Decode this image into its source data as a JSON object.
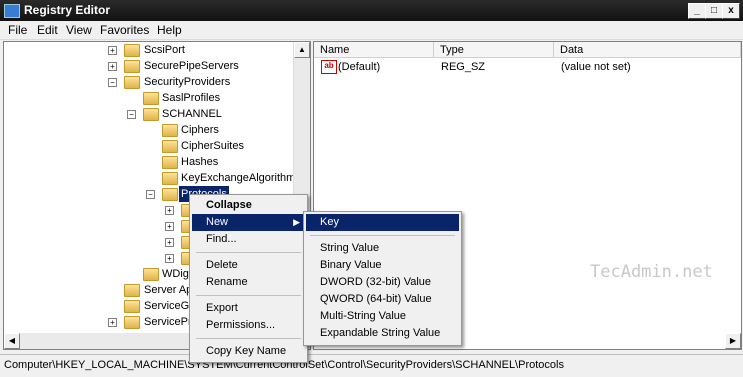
{
  "window": {
    "title": "Registry Editor",
    "minimize": "_",
    "maximize": "□",
    "close": "x"
  },
  "menu": [
    "File",
    "Edit",
    "View",
    "Favorites",
    "Help"
  ],
  "tree": {
    "items": [
      {
        "label": "ScsiPort",
        "expander": "+"
      },
      {
        "label": "SecurePipeServers",
        "expander": "+"
      },
      {
        "label": "SecurityProviders",
        "expander": "−"
      },
      {
        "label": "SaslProfiles",
        "expander": ""
      },
      {
        "label": "SCHANNEL",
        "expander": "−"
      },
      {
        "label": "Ciphers",
        "expander": ""
      },
      {
        "label": "CipherSuites",
        "expander": ""
      },
      {
        "label": "Hashes",
        "expander": ""
      },
      {
        "label": "KeyExchangeAlgorithm",
        "expander": ""
      },
      {
        "label": "Protocols",
        "expander": "−"
      },
      {
        "label": "",
        "expander": "+"
      },
      {
        "label": "",
        "expander": "+"
      },
      {
        "label": "",
        "expander": "+"
      },
      {
        "label": "",
        "expander": "+"
      },
      {
        "label": "WDigest",
        "expander": ""
      },
      {
        "label": "Server Applications",
        "expander": ""
      },
      {
        "label": "ServiceGroupOrder",
        "expander": ""
      },
      {
        "label": "ServiceProvider",
        "expander": "+"
      }
    ]
  },
  "values": {
    "headers": {
      "name": "Name",
      "type": "Type",
      "data": "Data"
    },
    "rows": [
      {
        "name": "(Default)",
        "type": "REG_SZ",
        "data": "(value not set)",
        "icon": "ab-icon"
      }
    ]
  },
  "context_menu": {
    "items": [
      "Collapse",
      "New",
      "Find...",
      "Delete",
      "Rename",
      "Export",
      "Permissions...",
      "Copy Key Name"
    ]
  },
  "submenu": {
    "items": [
      "Key",
      "String Value",
      "Binary Value",
      "DWORD (32-bit) Value",
      "QWORD (64-bit) Value",
      "Multi-String Value",
      "Expandable String Value"
    ]
  },
  "watermark": "TecAdmin.net",
  "status": "Computer\\HKEY_LOCAL_MACHINE\\SYSTEM\\CurrentControlSet\\Control\\SecurityProviders\\SCHANNEL\\Protocols",
  "colors": {
    "selection": "#0a246a",
    "titlebar": "#1a1a1a"
  }
}
